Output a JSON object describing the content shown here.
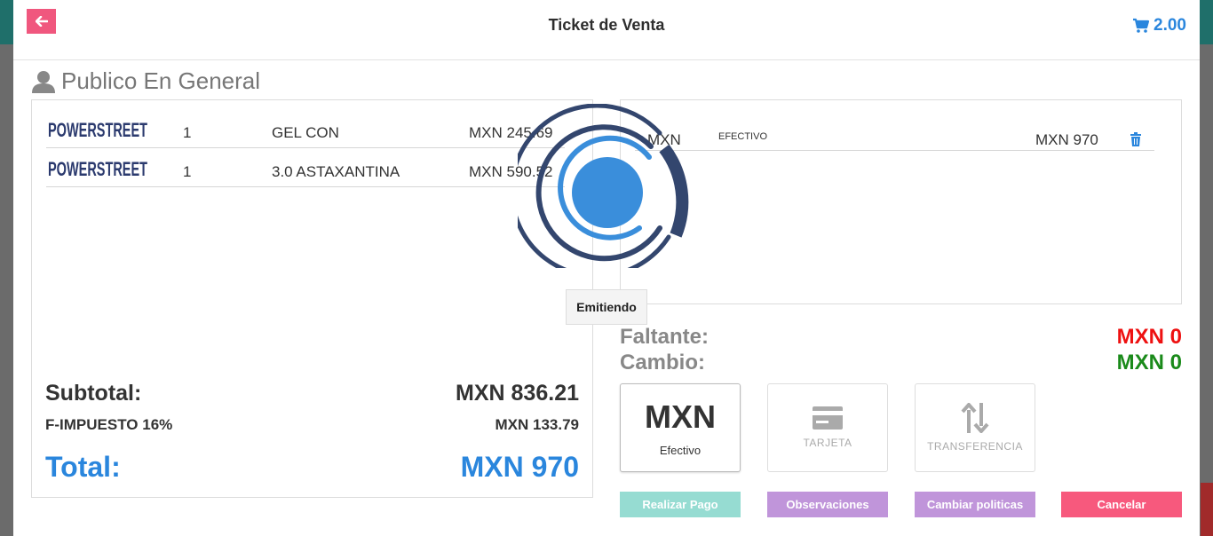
{
  "header": {
    "title": "Ticket de Venta",
    "cart_value": "2.00"
  },
  "customer": {
    "name": "Publico En General"
  },
  "items": [
    {
      "brand": "POWERSTREET",
      "qty": "1",
      "name": "GEL CON",
      "price": "MXN 245.69"
    },
    {
      "brand": "POWERSTREET",
      "qty": "1",
      "name": "3.0 ASTAXANTINA",
      "price": "MXN 590.52"
    }
  ],
  "summary": {
    "subtotal_label": "Subtotal:",
    "subtotal_value": "MXN 836.21",
    "tax_label": "F-IMPUESTO 16%",
    "tax_value": "MXN 133.79",
    "total_label": "Total:",
    "total_value": "MXN 970"
  },
  "payments": [
    {
      "currency": "MXN",
      "method": "EFECTIVO",
      "amount": "MXN 970"
    }
  ],
  "balance": {
    "faltante_label": "Faltante:",
    "faltante_value": "MXN 0",
    "cambio_label": "Cambio:",
    "cambio_value": "MXN 0"
  },
  "payment_methods": {
    "efectivo_big": "MXN",
    "efectivo_label": "Efectivo",
    "tarjeta_label": "TARJETA",
    "transferencia_label": "TRANSFERENCIA"
  },
  "actions": {
    "realizar_pago": "Realizar Pago",
    "observaciones": "Observaciones",
    "cambiar_politicas": "Cambiar politicas",
    "cancelar": "Cancelar"
  },
  "overlay": {
    "status_text": "Emitiendo"
  },
  "colors": {
    "accent_blue": "#2a86dd",
    "back_pink": "#f0577e",
    "faltante_red": "#ee1111",
    "cambio_green": "#1a8a1a",
    "realizar_pago_teal": "#96dcd2",
    "observaciones_purple": "#c095da",
    "cambiar_politicas_purple": "#c095da",
    "cancelar_pink": "#f7597d"
  }
}
